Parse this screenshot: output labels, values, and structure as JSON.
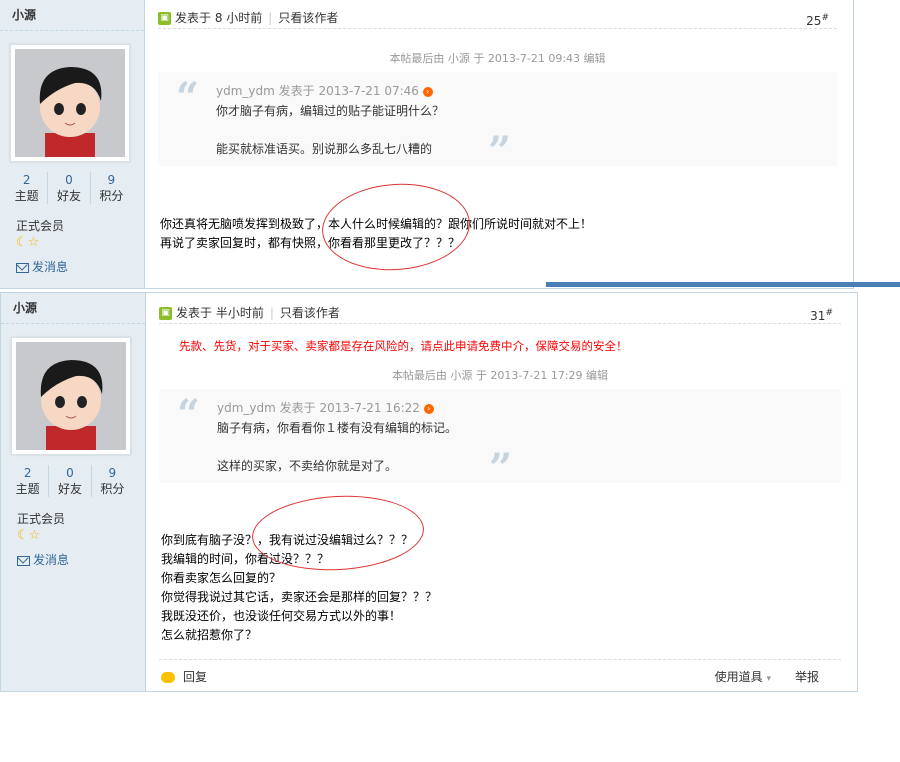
{
  "posts": [
    {
      "username": "小源",
      "stats": [
        {
          "value": "2",
          "label": "主题"
        },
        {
          "value": "0",
          "label": "好友"
        },
        {
          "value": "9",
          "label": "积分"
        }
      ],
      "rank": "正式会员",
      "send_message": "发消息",
      "posted_time": "发表于 8 小时前",
      "only_author": "只看该作者",
      "floor": "25",
      "floor_suffix": "#",
      "edited_note": "本帖最后由 小源 于 2013-7-21 09:43 编辑",
      "quote": {
        "header": "ydm_ydm 发表于 2013-7-21 07:46",
        "lines": [
          "你才脑子有病，编辑过的贴子能证明什么？",
          "能买就标准语买。别说那么多乱七八糟的"
        ]
      },
      "body": [
        "你还真将无脑喷发挥到极致了，本人什么时候编辑的？跟你们所说时间就对不上！",
        "再说了卖家回复时，都有快照，你看看那里更改了？？？"
      ]
    },
    {
      "username": "小源",
      "stats": [
        {
          "value": "2",
          "label": "主题"
        },
        {
          "value": "0",
          "label": "好友"
        },
        {
          "value": "9",
          "label": "积分"
        }
      ],
      "rank": "正式会员",
      "send_message": "发消息",
      "posted_time": "发表于 半小时前",
      "only_author": "只看该作者",
      "floor": "31",
      "floor_suffix": "#",
      "notice": "先款、先货，对于买家、卖家都是存在风险的，请点此申请免费中介，保障交易的安全！",
      "edited_note": "本帖最后由 小源 于 2013-7-21 17:29 编辑",
      "quote": {
        "header": "ydm_ydm 发表于 2013-7-21 16:22",
        "lines": [
          "脑子有病，你看看你１楼有没有编辑的标记。",
          "这样的买家，不卖给你就是对了。"
        ]
      },
      "body": [
        "你到底有脑子没？，我有说过没编辑过么？？？",
        "我编辑的时间，你看过没？？？",
        "你看卖家怎么回复的？",
        "你觉得我说过其它话，卖家还会是那样的回复？？？",
        "我既没还价，也没谈任何交易方式以外的事！",
        "怎么就招惹你了？"
      ],
      "footer": {
        "reply": "回复",
        "tools": "使用道具",
        "report": "举报"
      }
    }
  ],
  "colors": {
    "sidebar_bg": "#e5edf2",
    "border": "#c2d5e3",
    "link": "#336699",
    "annotation": "#dd3333",
    "notice": "#ff0000"
  },
  "icons": [
    "post-icon",
    "avatar-image",
    "star-icon",
    "moon-icon",
    "mail-icon",
    "goto-icon",
    "reply-icon",
    "dropdown-arrow-icon"
  ]
}
